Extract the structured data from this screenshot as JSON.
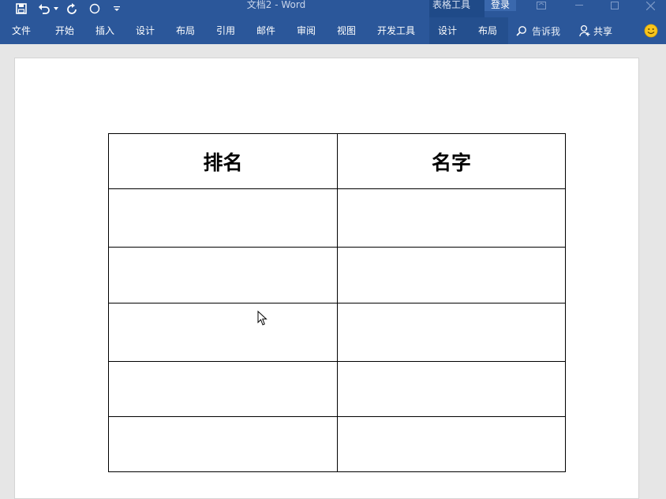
{
  "window": {
    "doc_title": "文档2 - Word",
    "context_tools_label": "表格工具",
    "login_label": "登录"
  },
  "ribbon": {
    "tabs": [
      {
        "label": "文件"
      },
      {
        "label": "开始"
      },
      {
        "label": "插入"
      },
      {
        "label": "设计"
      },
      {
        "label": "布局"
      },
      {
        "label": "引用"
      },
      {
        "label": "邮件"
      },
      {
        "label": "审阅"
      },
      {
        "label": "视图"
      },
      {
        "label": "开发工具"
      },
      {
        "label": "设计"
      },
      {
        "label": "布局"
      }
    ],
    "tell_me": "告诉我",
    "share": "共享"
  },
  "document": {
    "table": {
      "headers": [
        "排名",
        "名字"
      ],
      "rows": [
        [
          "",
          ""
        ],
        [
          "",
          ""
        ],
        [
          "",
          ""
        ],
        [
          "",
          ""
        ],
        [
          "",
          ""
        ]
      ]
    }
  },
  "colors": {
    "ribbon": "#2b579a",
    "context_tab": "#1f4a88",
    "page": "#ffffff",
    "workspace": "#e6e6e6"
  }
}
